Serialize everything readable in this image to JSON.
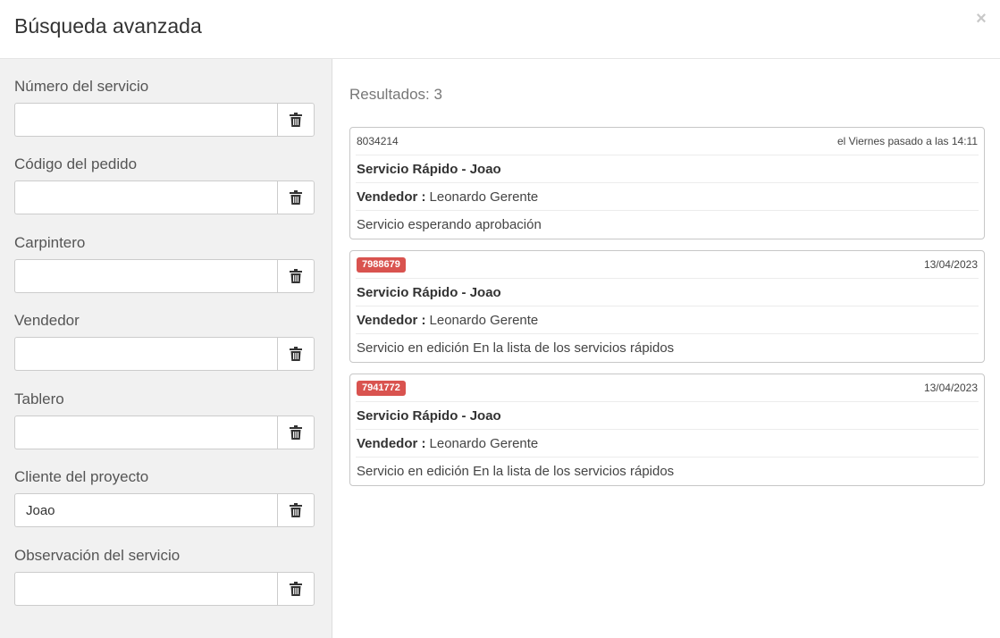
{
  "header": {
    "title": "Búsqueda avanzada",
    "close_label": "×"
  },
  "filters": [
    {
      "label": "Número del servicio",
      "value": "",
      "icon": "trash-icon"
    },
    {
      "label": "Código del pedido",
      "value": "",
      "icon": "trash-icon"
    },
    {
      "label": "Carpintero",
      "value": "",
      "icon": "trash-icon"
    },
    {
      "label": "Vendedor",
      "value": "",
      "icon": "trash-icon"
    },
    {
      "label": "Tablero",
      "value": "",
      "icon": "trash-icon"
    },
    {
      "label": "Cliente del proyecto",
      "value": "Joao",
      "icon": "trash-icon"
    },
    {
      "label": "Observación del servicio",
      "value": "",
      "icon": "trash-icon"
    }
  ],
  "results": {
    "count_label": "Resultados: 3",
    "items": [
      {
        "id": "8034214",
        "id_highlighted": false,
        "date": "el Viernes pasado a las 14:11",
        "title": "Servicio Rápido - Joao",
        "seller_key": "Vendedor :",
        "seller_value": "Leonardo Gerente",
        "status": "Servicio esperando aprobación"
      },
      {
        "id": "7988679",
        "id_highlighted": true,
        "date": "13/04/2023",
        "title": "Servicio Rápido - Joao",
        "seller_key": "Vendedor :",
        "seller_value": "Leonardo Gerente",
        "status": "Servicio en edición En la lista de los servicios rápidos"
      },
      {
        "id": "7941772",
        "id_highlighted": true,
        "date": "13/04/2023",
        "title": "Servicio Rápido - Joao",
        "seller_key": "Vendedor :",
        "seller_value": "Leonardo Gerente",
        "status": "Servicio en edición En la lista de los servicios rápidos"
      }
    ]
  },
  "colors": {
    "badge": "#d9534f",
    "sidebar_bg": "#f1f1f1"
  }
}
